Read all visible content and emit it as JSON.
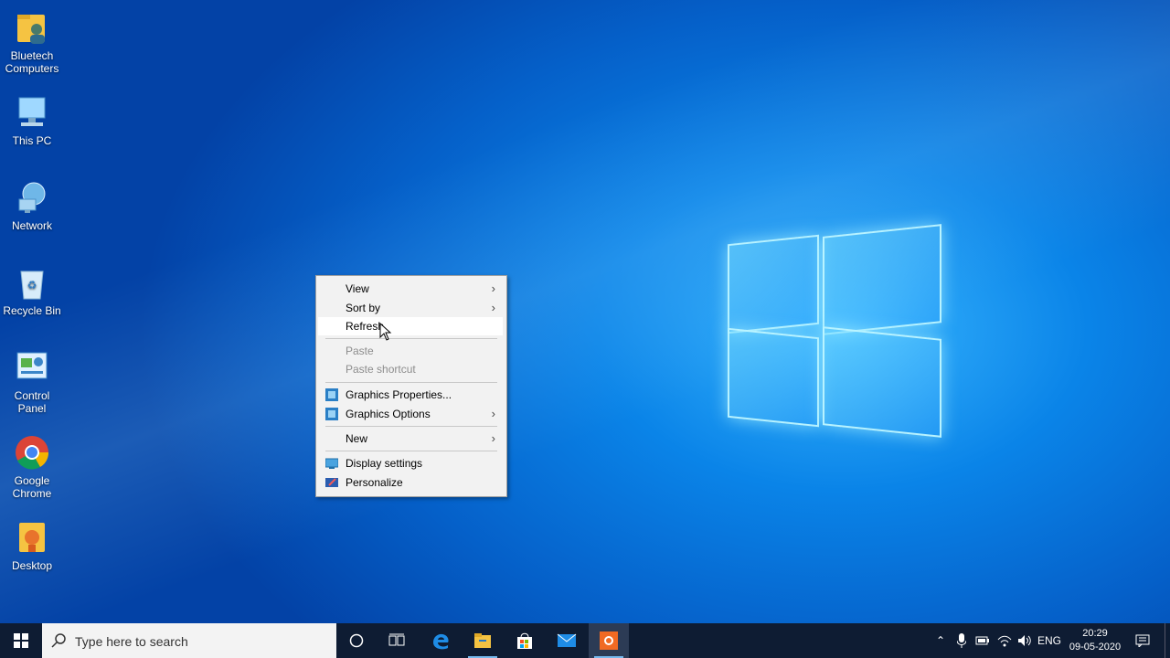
{
  "desktop_icons": [
    {
      "label": "Bluetech Computers",
      "icon": "user-folder-icon"
    },
    {
      "label": "This PC",
      "icon": "computer-icon"
    },
    {
      "label": "Network",
      "icon": "network-icon"
    },
    {
      "label": "Recycle Bin",
      "icon": "recycle-bin-icon"
    },
    {
      "label": "Control Panel",
      "icon": "control-panel-icon"
    },
    {
      "label": "Google Chrome",
      "icon": "chrome-icon"
    },
    {
      "label": "Desktop",
      "icon": "folder-icon"
    }
  ],
  "context_menu": {
    "view": "View",
    "sort_by": "Sort by",
    "refresh": "Refresh",
    "paste": "Paste",
    "paste_shortcut": "Paste shortcut",
    "graphics_properties": "Graphics Properties...",
    "graphics_options": "Graphics Options",
    "new": "New",
    "display_settings": "Display settings",
    "personalize": "Personalize"
  },
  "taskbar": {
    "search_placeholder": "Type here to search",
    "language": "ENG",
    "time": "20:29",
    "date": "09-05-2020"
  },
  "colors": {
    "taskbar": "#0e1c33",
    "menu_bg": "#f2f2f2",
    "accent": "#0078d7"
  }
}
